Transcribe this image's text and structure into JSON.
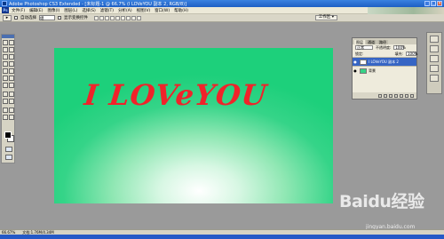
{
  "titlebar": {
    "title": "Adobe Photoshop CS3 Extended - [未标题-1 @ 66.7% (I LOVeYOU 副本 2, RGB/8)]",
    "controls": [
      "_",
      "□",
      "×"
    ]
  },
  "menubar": {
    "logo": "Ps",
    "items": [
      "文件(F)",
      "编辑(E)",
      "图像(I)",
      "图层(L)",
      "选择(S)",
      "滤镜(T)",
      "分析(A)",
      "视图(V)",
      "窗口(W)",
      "帮助(H)"
    ]
  },
  "options": {
    "auto_select_label": "自动选择",
    "auto_select_value": "组",
    "show_transform_label": "显示变换控件",
    "workspace_label": "工作区 ▾"
  },
  "document": {
    "text": "I LOVeYOU"
  },
  "layers_panel": {
    "tabs": [
      "图层",
      "通道",
      "路径"
    ],
    "blend_mode": "正常",
    "opacity_label": "不透明度:",
    "opacity_value": "100%",
    "lock_label": "锁定:",
    "fill_label": "填充:",
    "fill_value": "100%",
    "layers": [
      {
        "name": "I LOVeYOU 副本 2",
        "selected": true
      },
      {
        "name": "背景",
        "selected": false
      }
    ]
  },
  "statusbar": {
    "zoom": "66.67%",
    "doc_info": "文档:1.76M/4.34M"
  },
  "watermark": {
    "brand": "Baidu经验",
    "url": "jingyan.baidu.com"
  },
  "colors": {
    "text_red": "#f0232a",
    "canvas_green": "#1dd07b"
  }
}
